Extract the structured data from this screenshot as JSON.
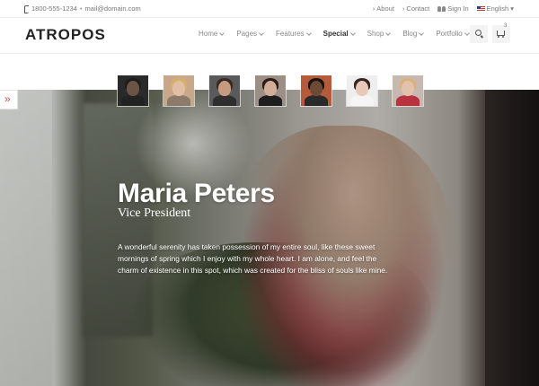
{
  "topbar": {
    "phone": "1800-555-1234",
    "separator": "•",
    "email": "mail@domain.com",
    "about": "About",
    "contact": "Contact",
    "signin": "Sign In",
    "language": "English"
  },
  "header": {
    "logo": "ATROPOS",
    "nav": [
      {
        "label": "Home"
      },
      {
        "label": "Pages"
      },
      {
        "label": "Features"
      },
      {
        "label": "Special",
        "active": true
      },
      {
        "label": "Shop"
      },
      {
        "label": "Blog"
      },
      {
        "label": "Portfolio"
      }
    ],
    "cart_count": "3"
  },
  "team": {
    "thumbnails": [
      {
        "bg": "#2a2a2a",
        "skin": "#6b5445",
        "hair": "#1d1d1d",
        "body": "#222222"
      },
      {
        "bg": "#c9a88a",
        "skin": "#e2bfa4",
        "hair": "#d6b06a",
        "body": "#8c7b6b"
      },
      {
        "bg": "#5a5a5a",
        "skin": "#c49b7e",
        "hair": "#3a2a22",
        "body": "#2e2e2e"
      },
      {
        "bg": "#9c8f85",
        "skin": "#d2ae98",
        "hair": "#2b1c18",
        "body": "#1e1e1e"
      },
      {
        "bg": "#b55a3a",
        "skin": "#6d4a36",
        "hair": "#1a1410",
        "body": "#2a2a2a"
      },
      {
        "bg": "#eeeeee",
        "skin": "#e8c8b6",
        "hair": "#3a2420",
        "body": "#f5f5f5"
      },
      {
        "bg": "#c7b9b0",
        "skin": "#e3c2ad",
        "hair": "#d9b27a",
        "body": "#b8323f"
      }
    ],
    "member": {
      "name": "Maria Peters",
      "role": "Vice President",
      "bio": "A wonderful serenity has taken possession of my entire soul, like these sweet mornings of spring which I enjoy with my whole heart. I am alone, and feel the charm of existence in this spot, which was created for the bliss of souls like mine."
    }
  },
  "colors": {
    "accent": "#d9534f",
    "text_dark": "#222222"
  }
}
